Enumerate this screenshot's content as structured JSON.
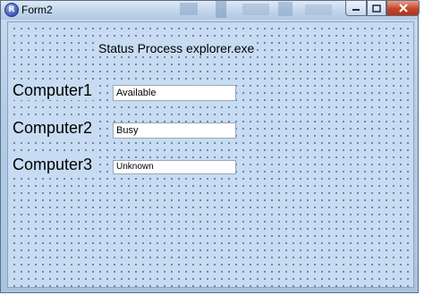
{
  "window": {
    "title": "Form2",
    "app_icon": "app-icon",
    "controls": {
      "minimize_icon": "minimize-icon",
      "maximize_icon": "maximize-icon",
      "close_icon": "close-icon"
    }
  },
  "form": {
    "heading": "Status Process explorer.exe",
    "rows": [
      {
        "label": "Computer1",
        "value": "Available"
      },
      {
        "label": "Computer2",
        "value": "Busy"
      },
      {
        "label": "Computer3",
        "value": "Unknown"
      }
    ]
  },
  "colors": {
    "client_background": "#c7dcf2",
    "close_button": "#c7452a"
  }
}
